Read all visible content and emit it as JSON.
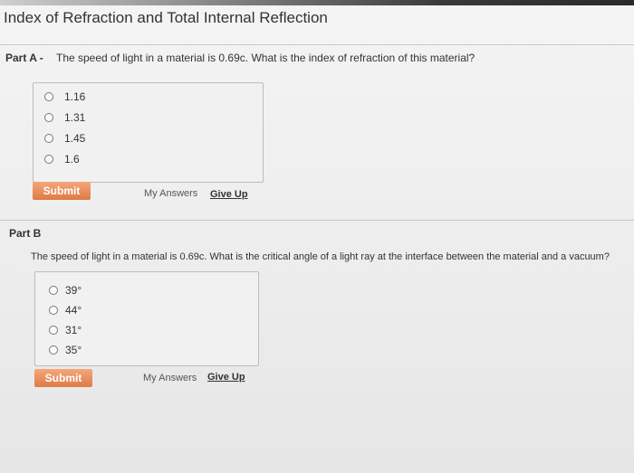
{
  "page_title": "Index of Refraction and Total Internal Reflection",
  "part_a": {
    "label": "Part A -",
    "question": "The speed of light in a material is 0.69c. What is the index of refraction of this material?",
    "choices": [
      "1.16",
      "1.31",
      "1.45",
      "1.6"
    ],
    "submit_label": "Submit",
    "my_answers_label": "My Answers",
    "give_up_label": "Give Up"
  },
  "part_b": {
    "label": "Part B",
    "question": "The speed of light in a material is 0.69c. What is the critical angle of a light ray at the interface between the material and a vacuum?",
    "choices": [
      "39°",
      "44°",
      "31°",
      "35°"
    ],
    "submit_label": "Submit",
    "my_answers_label": "My Answers",
    "give_up_label": "Give Up"
  },
  "colors": {
    "submit_button": "#e88a55",
    "text": "#333333"
  }
}
